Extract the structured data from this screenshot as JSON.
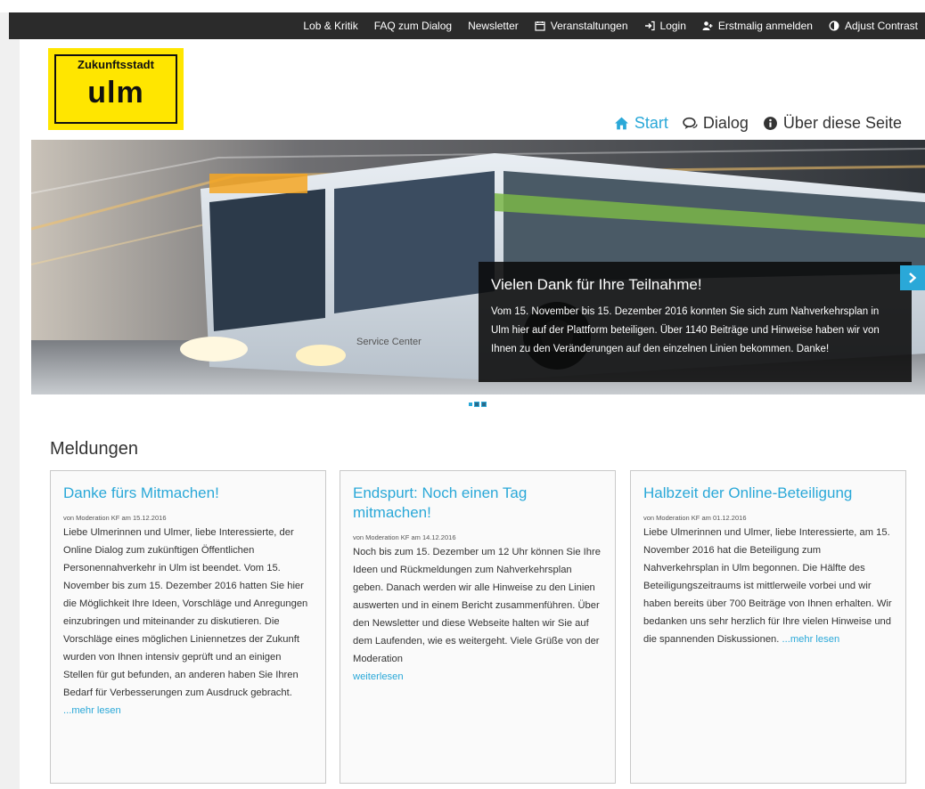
{
  "topbar": {
    "items": [
      {
        "label": "Lob & Kritik",
        "icon": ""
      },
      {
        "label": "FAQ zum Dialog",
        "icon": ""
      },
      {
        "label": "Newsletter",
        "icon": ""
      },
      {
        "label": "Veranstaltungen",
        "icon": "calendar-icon"
      },
      {
        "label": "Login",
        "icon": "sign-in-icon"
      },
      {
        "label": "Erstmalig anmelden",
        "icon": "user-plus-icon"
      },
      {
        "label": "Adjust Contrast",
        "icon": "contrast-icon"
      }
    ]
  },
  "logo": {
    "line1": "Zukunftsstadt",
    "line2": "ulm"
  },
  "nav": {
    "items": [
      {
        "label": "Start",
        "icon": "home-icon",
        "active": true
      },
      {
        "label": "Dialog",
        "icon": "comments-icon",
        "active": false
      },
      {
        "label": "Über diese Seite",
        "icon": "info-icon",
        "active": false
      }
    ]
  },
  "hero": {
    "title": "Vielen Dank für Ihre Teilnahme!",
    "text": "Vom 15. November bis 15. Dezember 2016 konnten Sie sich zum Nahverkehrsplan in Ulm hier auf der Plattform beteiligen. Über 1140 Beiträge und Hinweise haben wir von Ihnen zu den Veränderungen auf den einzelnen Linien bekommen. Danke!",
    "bus_label": "Service Center",
    "slides": 3,
    "active_slide": 1
  },
  "section": {
    "title": "Meldungen"
  },
  "cards": [
    {
      "title": "Danke fürs Mitmachen!",
      "meta": "von Moderation KF am 15.12.2016",
      "body": "Liebe Ulmerinnen und Ulmer, liebe Interessierte, der Online Dialog zum zukünftigen Öffentlichen Personennahverkehr in Ulm ist beendet. Vom 15. November bis zum 15. Dezember 2016 hatten Sie hier die Möglichkeit Ihre Ideen, Vorschläge und Anregungen einzubringen und miteinander zu diskutieren. Die Vorschläge eines möglichen Liniennetzes der Zukunft wurden von Ihnen intensiv geprüft und an einigen Stellen für gut befunden, an anderen haben Sie Ihren Bedarf für Verbesserungen zum Ausdruck gebracht. ",
      "more": "...mehr lesen"
    },
    {
      "title": "Endspurt: Noch einen Tag mitmachen!",
      "meta": "von Moderation KF am 14.12.2016",
      "body": "Noch bis zum 15. Dezember um 12 Uhr können Sie Ihre Ideen und Rückmeldungen zum Nahverkehrsplan geben. Danach werden wir alle Hinweise zu den Linien auswerten und in einem Bericht zusammenführen. Über den Newsletter und diese Webseite halten wir Sie auf dem Laufenden, wie es weitergeht. Viele Grüße von der Moderation ",
      "more": "weiterlesen"
    },
    {
      "title": "Halbzeit der Online-Beteiligung",
      "meta": "von Moderation KF am 01.12.2016",
      "body": "Liebe Ulmerinnen und Ulmer, liebe Interessierte, am 15. November 2016 hat die Beteiligung zum Nahverkehrsplan in Ulm begonnen. Die Hälfte des Beteiligungszeitraums ist mittlerweile vorbei und wir haben bereits über 700 Beiträge von Ihnen erhalten. Wir bedanken uns sehr herzlich für Ihre vielen Hinweise und die spannenden Diskussionen. ",
      "more": "...mehr lesen"
    }
  ],
  "colors": {
    "accent": "#2aa8d8",
    "topbar": "#2b2b2b",
    "logo": "#ffe600"
  }
}
